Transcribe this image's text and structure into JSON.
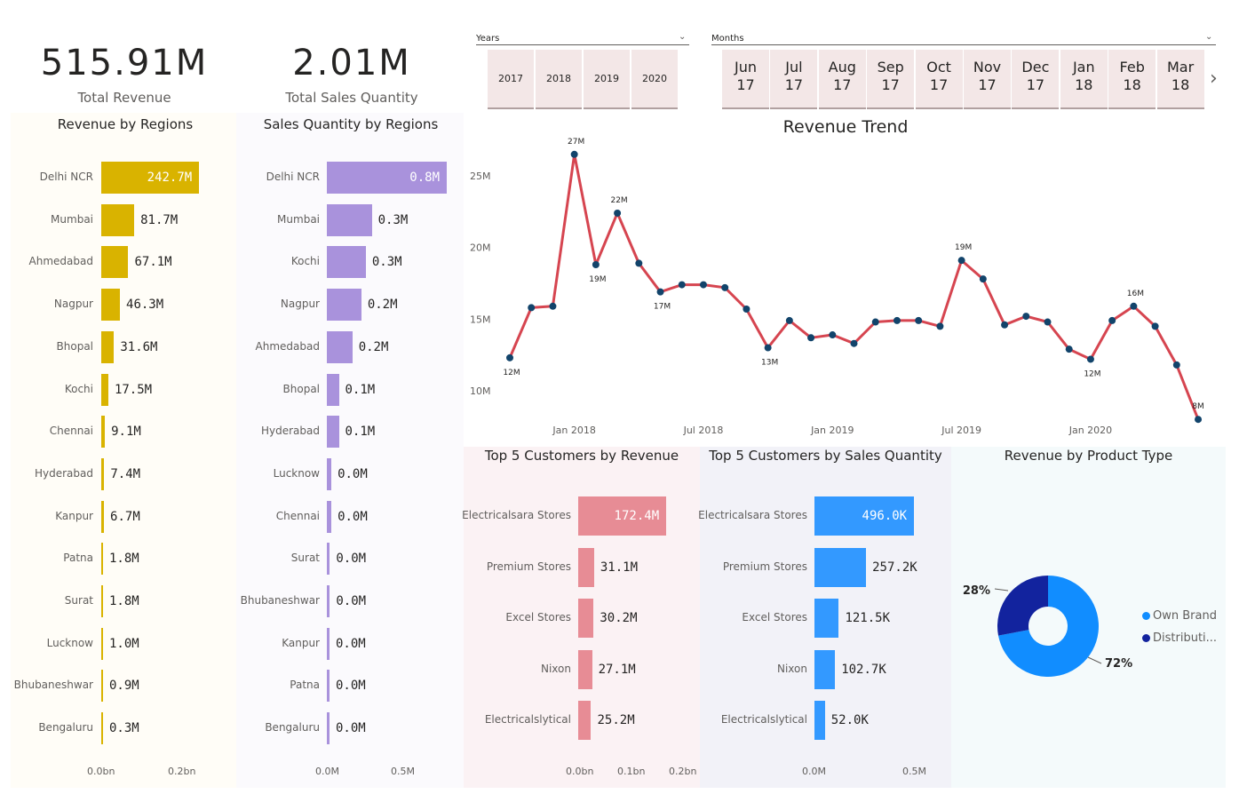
{
  "kpis": {
    "revenue": {
      "value": "515.91M",
      "label": "Total Revenue"
    },
    "quantity": {
      "value": "2.01M",
      "label": "Total Sales Quantity"
    }
  },
  "slicers": {
    "years": {
      "label": "Years",
      "options": [
        "2017",
        "2018",
        "2019",
        "2020"
      ]
    },
    "months": {
      "label": "Months",
      "options": [
        [
          "Jun",
          "17"
        ],
        [
          "Jul",
          "17"
        ],
        [
          "Aug",
          "17"
        ],
        [
          "Sep",
          "17"
        ],
        [
          "Oct",
          "17"
        ],
        [
          "Nov",
          "17"
        ],
        [
          "Dec",
          "17"
        ],
        [
          "Jan",
          "18"
        ],
        [
          "Feb",
          "18"
        ],
        [
          "Mar",
          "18"
        ]
      ]
    }
  },
  "colors": {
    "revenue_regions": "#d9b300",
    "qty_regions": "#a992dc",
    "top_rev": "#e78c95",
    "top_qty": "#3399ff",
    "trend_line": "#d64550",
    "trend_point": "#12446b",
    "own_brand": "#118dff",
    "distribution": "#12239e"
  },
  "chart_data": [
    {
      "id": "revenue_by_regions",
      "type": "bar",
      "title": "Revenue by Regions",
      "categories": [
        "Delhi NCR",
        "Mumbai",
        "Ahmedabad",
        "Nagpur",
        "Bhopal",
        "Kochi",
        "Chennai",
        "Hyderabad",
        "Kanpur",
        "Patna",
        "Surat",
        "Lucknow",
        "Bhubaneshwar",
        "Bengaluru"
      ],
      "values": [
        242.7,
        81.7,
        67.1,
        46.3,
        31.6,
        17.5,
        9.1,
        7.4,
        6.7,
        1.8,
        1.8,
        1.0,
        0.9,
        0.3
      ],
      "labels": [
        "242.7M",
        "81.7M",
        "67.1M",
        "46.3M",
        "31.6M",
        "17.5M",
        "9.1M",
        "7.4M",
        "6.7M",
        "1.8M",
        "1.8M",
        "1.0M",
        "0.9M",
        "0.3M"
      ],
      "unit": "M",
      "xticks": [
        "0.0bn",
        "0.2bn"
      ],
      "xlim": [
        0,
        240
      ]
    },
    {
      "id": "qty_by_regions",
      "type": "bar",
      "title": "Sales Quantity by Regions",
      "categories": [
        "Delhi NCR",
        "Mumbai",
        "Kochi",
        "Nagpur",
        "Ahmedabad",
        "Bhopal",
        "Hyderabad",
        "Lucknow",
        "Chennai",
        "Surat",
        "Bhubaneshwar",
        "Kanpur",
        "Patna",
        "Bengaluru"
      ],
      "values": [
        0.8,
        0.3,
        0.26,
        0.23,
        0.17,
        0.08,
        0.08,
        0.03,
        0.03,
        0.02,
        0.02,
        0.01,
        0.01,
        0.01
      ],
      "labels": [
        "0.8M",
        "0.3M",
        "0.3M",
        "0.2M",
        "0.2M",
        "0.1M",
        "0.1M",
        "0.0M",
        "0.0M",
        "0.0M",
        "0.0M",
        "0.0M",
        "0.0M",
        "0.0M"
      ],
      "xticks": [
        "0.0M",
        "0.5M"
      ],
      "xlim": [
        0,
        0.8
      ]
    },
    {
      "id": "revenue_trend",
      "type": "line",
      "title": "Revenue Trend",
      "x": [
        "2017-10",
        "2017-11",
        "2017-12",
        "2018-01",
        "2018-02",
        "2018-03",
        "2018-04",
        "2018-05",
        "2018-06",
        "2018-07",
        "2018-08",
        "2018-09",
        "2018-10",
        "2018-11",
        "2018-12",
        "2019-01",
        "2019-02",
        "2019-03",
        "2019-04",
        "2019-05",
        "2019-06",
        "2019-07",
        "2019-08",
        "2019-09",
        "2019-10",
        "2019-11",
        "2019-12",
        "2020-01",
        "2020-02",
        "2020-03",
        "2020-04",
        "2020-05",
        "2020-06"
      ],
      "values": [
        12.3,
        15.8,
        15.9,
        26.5,
        18.8,
        22.4,
        18.9,
        16.9,
        17.4,
        17.4,
        17.2,
        15.7,
        13.0,
        14.9,
        13.7,
        13.9,
        13.3,
        14.8,
        14.9,
        14.9,
        14.5,
        19.1,
        17.8,
        14.6,
        15.2,
        14.8,
        12.9,
        12.2,
        14.9,
        15.9,
        14.5,
        11.8,
        8.0
      ],
      "point_labels": {
        "0": "12M",
        "3": "27M",
        "4": "19M",
        "5": "22M",
        "7": "17M",
        "12": "13M",
        "21": "19M",
        "27": "12M",
        "29": "16M",
        "32": "8M"
      },
      "yticks": [
        "10M",
        "15M",
        "20M",
        "25M"
      ],
      "ylim": [
        8,
        28
      ],
      "xticks": [
        "Jan 2018",
        "Jul 2018",
        "Jan 2019",
        "Jul 2019",
        "Jan 2020"
      ]
    },
    {
      "id": "top5_customers_revenue",
      "type": "bar",
      "title": "Top 5 Customers by Revenue",
      "categories": [
        "Electricalsara Stores",
        "Premium Stores",
        "Excel Stores",
        "Nixon",
        "Electricalslytical"
      ],
      "values": [
        172.4,
        31.1,
        30.2,
        27.1,
        25.2
      ],
      "labels": [
        "172.4M",
        "31.1M",
        "30.2M",
        "27.1M",
        "25.2M"
      ],
      "xticks": [
        "0.0bn",
        "0.1bn",
        "0.2bn"
      ],
      "xlim": [
        0,
        200
      ]
    },
    {
      "id": "top5_customers_qty",
      "type": "bar",
      "title": "Top 5 Customers by Sales Quantity",
      "categories": [
        "Electricalsara Stores",
        "Premium Stores",
        "Excel Stores",
        "Nixon",
        "Electricalslytical"
      ],
      "values": [
        496.0,
        257.2,
        121.5,
        102.7,
        52.0
      ],
      "labels": [
        "496.0K",
        "257.2K",
        "121.5K",
        "102.7K",
        "52.0K"
      ],
      "xticks": [
        "0.0M",
        "0.5M"
      ],
      "xlim": [
        0,
        500
      ]
    },
    {
      "id": "revenue_by_product_type",
      "type": "pie",
      "title": "Revenue by Product Type",
      "categories": [
        "Own Brand",
        "Distributi..."
      ],
      "values": [
        72,
        28
      ],
      "labels": [
        "72%",
        "28%"
      ]
    }
  ]
}
